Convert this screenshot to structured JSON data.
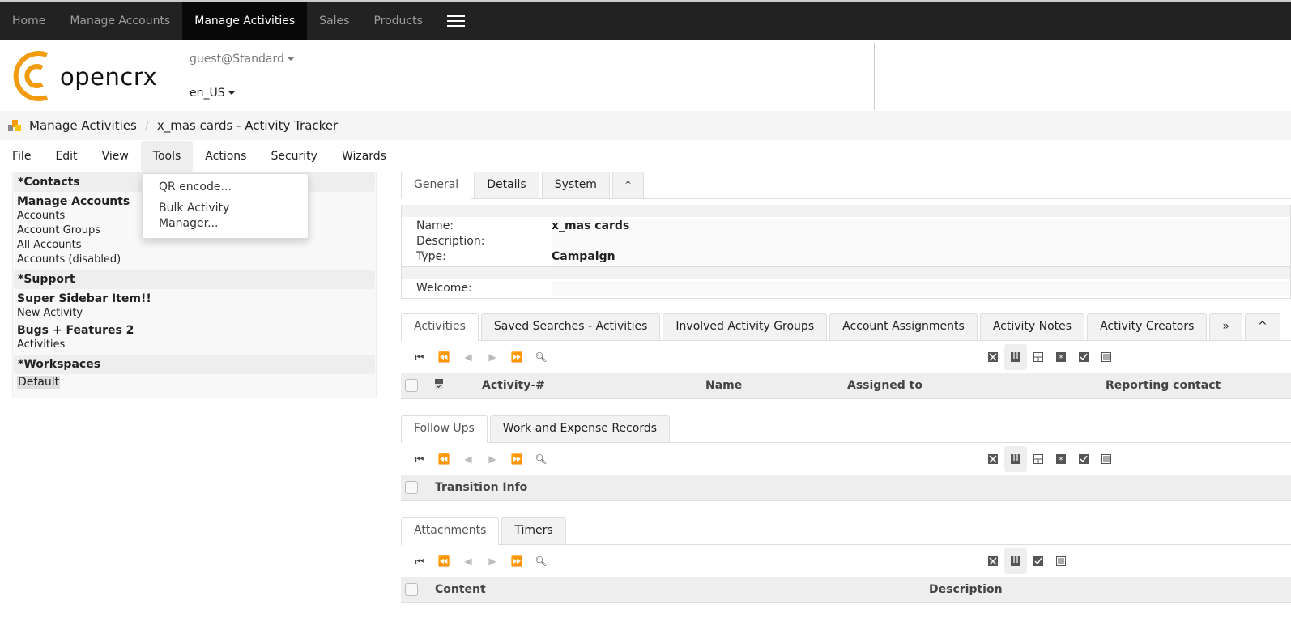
{
  "topnav": {
    "items": [
      {
        "label": "Home",
        "active": false
      },
      {
        "label": "Manage Accounts",
        "active": false
      },
      {
        "label": "Manage Activities",
        "active": true
      },
      {
        "label": "Sales",
        "active": false
      },
      {
        "label": "Products",
        "active": false
      }
    ],
    "menu_icon": "hamburger-icon"
  },
  "header": {
    "logo_text": "opencrx",
    "brand_color": "#f29b0c",
    "user": "guest@Standard",
    "locale": "en_US"
  },
  "breadcrumb": {
    "section": "Manage Activities",
    "page": "x_mas cards - Activity Tracker"
  },
  "menubar": {
    "items": [
      "File",
      "Edit",
      "View",
      "Tools",
      "Actions",
      "Security",
      "Wizards"
    ],
    "open_menu": "Tools",
    "tools_menu": [
      "QR encode...",
      "Bulk Activity Manager..."
    ]
  },
  "sidebar": {
    "contacts_header": "*Contacts",
    "contacts_title": "Manage Accounts",
    "contacts_links": [
      "Accounts",
      "Account Groups",
      "All Accounts",
      "Accounts (disabled)"
    ],
    "support_header": "*Support",
    "support_title1": "Super Sidebar Item!!",
    "support_link1": "New Activity",
    "support_title2": "Bugs + Features 2",
    "support_link2": "Activities",
    "workspaces_header": "*Workspaces",
    "workspace": "Default"
  },
  "detail_tabs": [
    "General",
    "Details",
    "System",
    "*"
  ],
  "details": {
    "name_label": "Name:",
    "name_value": "x_mas cards",
    "description_label": "Description:",
    "description_value": "",
    "type_label": "Type:",
    "type_value": "Campaign",
    "welcome_label": "Welcome:",
    "welcome_value": ""
  },
  "activities_tabs": [
    "Activities",
    "Saved Searches - Activities",
    "Involved Activity Groups",
    "Account Assignments",
    "Activity Notes",
    "Activity Creators",
    "»",
    "^"
  ],
  "activities_grid": {
    "columns": [
      "Activity-#",
      "Name",
      "Assigned to",
      "Reporting contact"
    ]
  },
  "followups_tabs": [
    "Follow Ups",
    "Work and Expense Records"
  ],
  "followups_grid": {
    "columns": [
      "Transition Info"
    ]
  },
  "attachments_tabs": [
    "Attachments",
    "Timers"
  ],
  "attachments_grid": {
    "columns": [
      "Content",
      "Description"
    ]
  }
}
